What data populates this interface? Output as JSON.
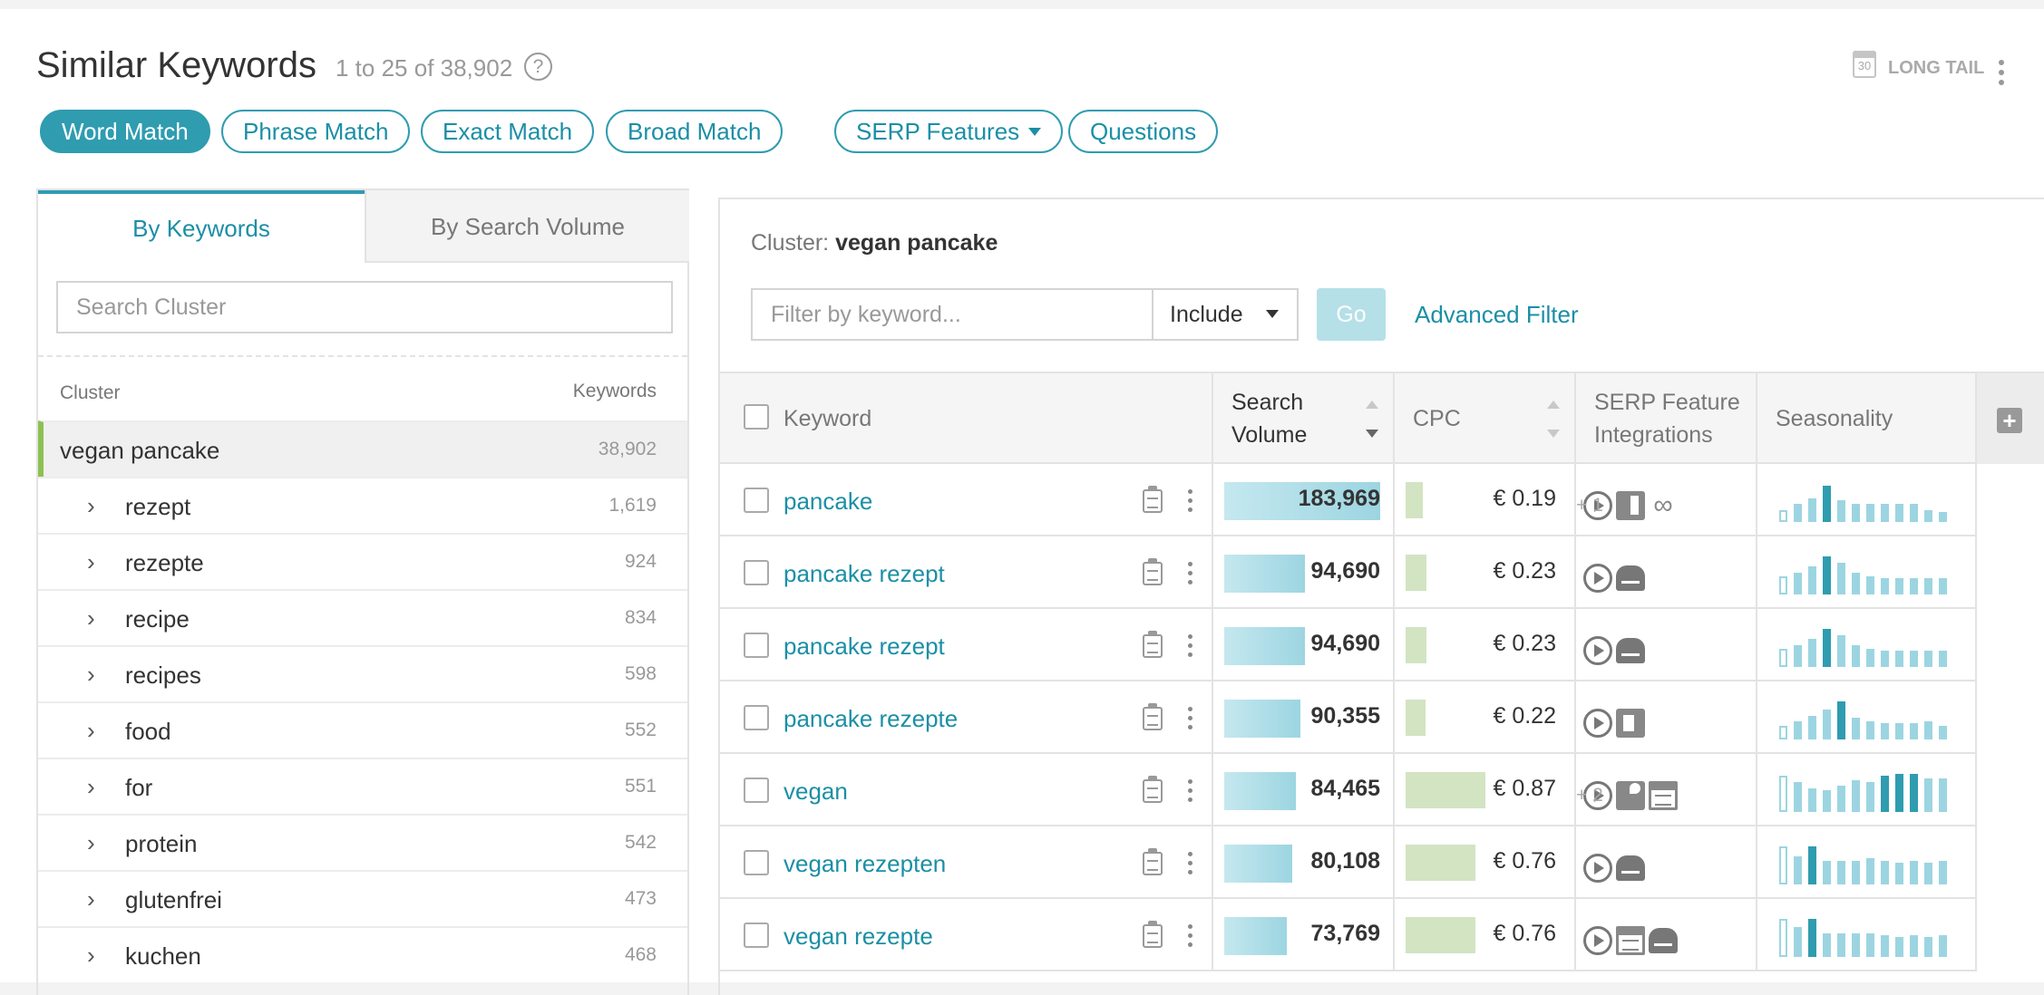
{
  "header": {
    "title": "Similar Keywords",
    "range": "1 to 25 of 38,902",
    "help": "?",
    "longtail_label": "LONG TAIL",
    "calendar_day": "30"
  },
  "match_tabs": [
    {
      "label": "Word Match",
      "active": true
    },
    {
      "label": "Phrase Match",
      "active": false
    },
    {
      "label": "Exact Match",
      "active": false
    },
    {
      "label": "Broad Match",
      "active": false
    },
    {
      "label": "SERP Features",
      "active": false,
      "dropdown": true
    },
    {
      "label": "Questions",
      "active": false
    }
  ],
  "left_panel": {
    "tabs": [
      "By Keywords",
      "By Search Volume"
    ],
    "active_tab": "By Keywords",
    "search_placeholder": "Search Cluster",
    "col_cluster": "Cluster",
    "col_keywords": "Keywords",
    "clusters": [
      {
        "name": "vegan pancake",
        "count": "38,902",
        "selected": true
      },
      {
        "name": "rezept",
        "count": "1,619"
      },
      {
        "name": "rezepte",
        "count": "924"
      },
      {
        "name": "recipe",
        "count": "834"
      },
      {
        "name": "recipes",
        "count": "598"
      },
      {
        "name": "food",
        "count": "552"
      },
      {
        "name": "for",
        "count": "551"
      },
      {
        "name": "protein",
        "count": "542"
      },
      {
        "name": "glutenfrei",
        "count": "473"
      },
      {
        "name": "kuchen",
        "count": "468"
      }
    ]
  },
  "right_panel": {
    "cluster_prefix": "Cluster:",
    "cluster_name": "vegan pancake",
    "filter_placeholder": "Filter by keyword...",
    "include_label": "Include",
    "go_label": "Go",
    "advanced_filter": "Advanced Filter",
    "columns": {
      "keyword": "Keyword",
      "search_volume_1": "Search",
      "search_volume_2": "Volume",
      "cpc": "CPC",
      "serp_1": "SERP Feature",
      "serp_2": "Integrations",
      "seasonality": "Seasonality",
      "add": "+"
    },
    "rows": [
      {
        "keyword": "pancake",
        "volume": "183,969",
        "volume_frac": 1.0,
        "cpc": "€ 0.19",
        "cpc_frac": 0.22,
        "features": [
          "play-icon",
          "panel-icon",
          "link-icon"
        ],
        "more": "+ 1",
        "seasonality": [
          0.3,
          0.45,
          0.6,
          0.9,
          0.55,
          0.45,
          0.45,
          0.45,
          0.45,
          0.45,
          0.3,
          0.25
        ],
        "hi": [
          3
        ]
      },
      {
        "keyword": "pancake rezept",
        "volume": "94,690",
        "volume_frac": 0.515,
        "cpc": "€ 0.23",
        "cpc_frac": 0.26,
        "features": [
          "play-icon",
          "chef-icon"
        ],
        "more": "",
        "seasonality": [
          0.45,
          0.55,
          0.7,
          0.95,
          0.8,
          0.55,
          0.45,
          0.4,
          0.4,
          0.4,
          0.4,
          0.4
        ],
        "hi": [
          3
        ]
      },
      {
        "keyword": "pancake rezept",
        "volume": "94,690",
        "volume_frac": 0.515,
        "cpc": "€ 0.23",
        "cpc_frac": 0.26,
        "features": [
          "play-icon",
          "chef-icon"
        ],
        "more": "",
        "seasonality": [
          0.45,
          0.55,
          0.7,
          0.95,
          0.8,
          0.55,
          0.45,
          0.4,
          0.4,
          0.4,
          0.4,
          0.4
        ],
        "hi": [
          3
        ]
      },
      {
        "keyword": "pancake rezepte",
        "volume": "90,355",
        "volume_frac": 0.49,
        "cpc": "€ 0.22",
        "cpc_frac": 0.25,
        "features": [
          "play-icon",
          "video-icon"
        ],
        "more": "",
        "seasonality": [
          0.35,
          0.45,
          0.6,
          0.75,
          0.95,
          0.55,
          0.45,
          0.4,
          0.4,
          0.4,
          0.45,
          0.35
        ],
        "hi": [
          4
        ]
      },
      {
        "keyword": "vegan",
        "volume": "84,465",
        "volume_frac": 0.46,
        "cpc": "€ 0.87",
        "cpc_frac": 1.0,
        "features": [
          "play-icon",
          "map-icon",
          "news-icon"
        ],
        "more": "+ 2",
        "seasonality": [
          0.9,
          0.75,
          0.6,
          0.55,
          0.65,
          0.8,
          0.75,
          0.9,
          0.95,
          0.95,
          0.85,
          0.85
        ],
        "hi": [
          7,
          8,
          9
        ]
      },
      {
        "keyword": "vegan rezepten",
        "volume": "80,108",
        "volume_frac": 0.435,
        "cpc": "€ 0.76",
        "cpc_frac": 0.87,
        "features": [
          "play-icon",
          "chef-icon"
        ],
        "more": "",
        "seasonality": [
          0.95,
          0.7,
          0.95,
          0.6,
          0.6,
          0.6,
          0.65,
          0.6,
          0.55,
          0.6,
          0.55,
          0.6
        ],
        "hi": [
          2
        ]
      },
      {
        "keyword": "vegan rezepte",
        "volume": "73,769",
        "volume_frac": 0.4,
        "cpc": "€ 0.76",
        "cpc_frac": 0.87,
        "features": [
          "play-icon",
          "news-icon",
          "chef-icon"
        ],
        "more": "",
        "seasonality": [
          0.95,
          0.75,
          0.95,
          0.6,
          0.6,
          0.6,
          0.6,
          0.55,
          0.5,
          0.55,
          0.5,
          0.55
        ],
        "hi": [
          2
        ]
      }
    ]
  }
}
